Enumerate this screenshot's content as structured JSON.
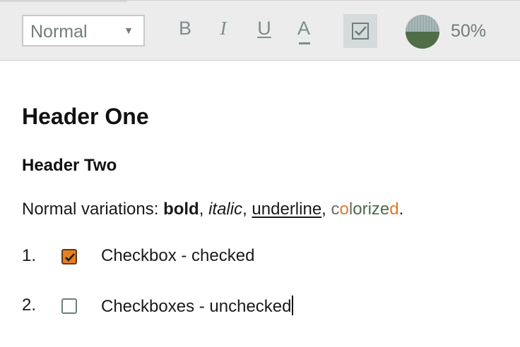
{
  "toolbar": {
    "format_select": {
      "selected": "Normal",
      "caret": "▼"
    },
    "buttons": {
      "bold": "B",
      "italic": "I",
      "underline": "U",
      "color": "A"
    },
    "zoom": {
      "label": "50%",
      "level_fraction": 0.5
    }
  },
  "editor": {
    "header_one": "Header One",
    "header_two": "Header Two",
    "paragraph": {
      "prefix": "Normal variations: ",
      "bold": "bold",
      "sep1": ", ",
      "italic": "italic",
      "sep2": ", ",
      "underline": "underline",
      "sep3": ", ",
      "colorized_letters": [
        "c",
        "o",
        "l",
        "o",
        "r",
        "i",
        "z",
        "e",
        "d"
      ],
      "suffix": "."
    },
    "list": [
      {
        "number": "1.",
        "checked": true,
        "label": "Checkbox - checked"
      },
      {
        "number": "2.",
        "checked": false,
        "label": "Checkboxes - unchecked"
      }
    ]
  },
  "colors": {
    "accent_orange": "#e67e22",
    "green": "#4d6b4a",
    "toolbar_icon": "#7e8c8c"
  }
}
